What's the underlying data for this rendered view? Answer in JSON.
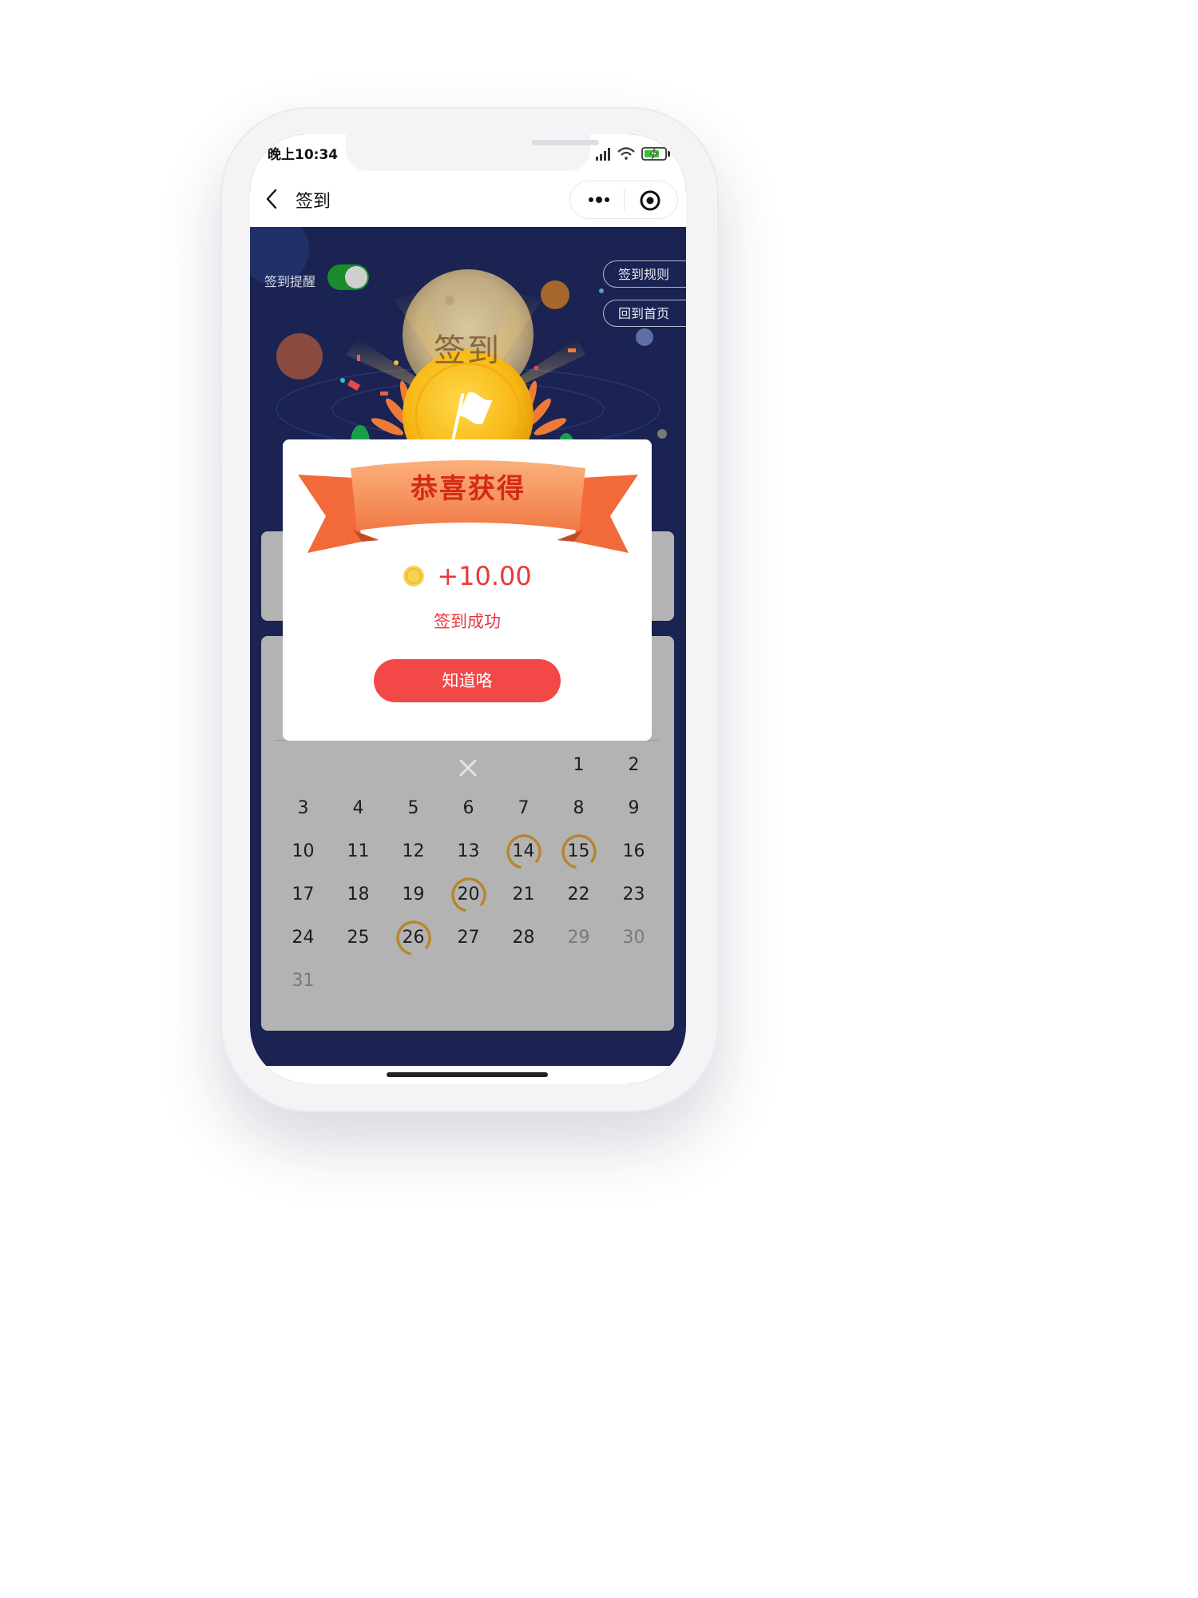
{
  "status_bar": {
    "time": "晚上10:34"
  },
  "nav": {
    "title": "签到"
  },
  "hero": {
    "remind_label": "签到提醒",
    "remind_on": true,
    "rules_button": "签到规则",
    "home_button": "回到首页",
    "moon_text": "签到"
  },
  "popup": {
    "ribbon_title": "恭喜获得",
    "amount": "+10.00",
    "status": "签到成功",
    "confirm_button": "知道咯"
  },
  "calendar": {
    "rows": [
      [
        null,
        null,
        null,
        "x",
        null,
        "1",
        "2"
      ],
      [
        "3",
        "4",
        "5",
        "6",
        "7",
        "8",
        "9"
      ],
      [
        "10",
        "11",
        "12",
        "13",
        "14",
        "15",
        "16"
      ],
      [
        "17",
        "18",
        "19",
        "20",
        "21",
        "22",
        "23"
      ],
      [
        "24",
        "25",
        "26",
        "27",
        "28",
        "29",
        "30"
      ],
      [
        "31",
        null,
        null,
        null,
        null,
        null,
        null
      ]
    ],
    "checked_days": [
      "14",
      "15",
      "20",
      "26"
    ],
    "muted_days": [
      "29",
      "30",
      "31"
    ]
  },
  "colors": {
    "accent_red": "#e8383d",
    "button_red": "#f34848",
    "hero_bg": "#1a2352",
    "switch_on": "#1a8c2c",
    "ring_gold": "#b8862e"
  }
}
